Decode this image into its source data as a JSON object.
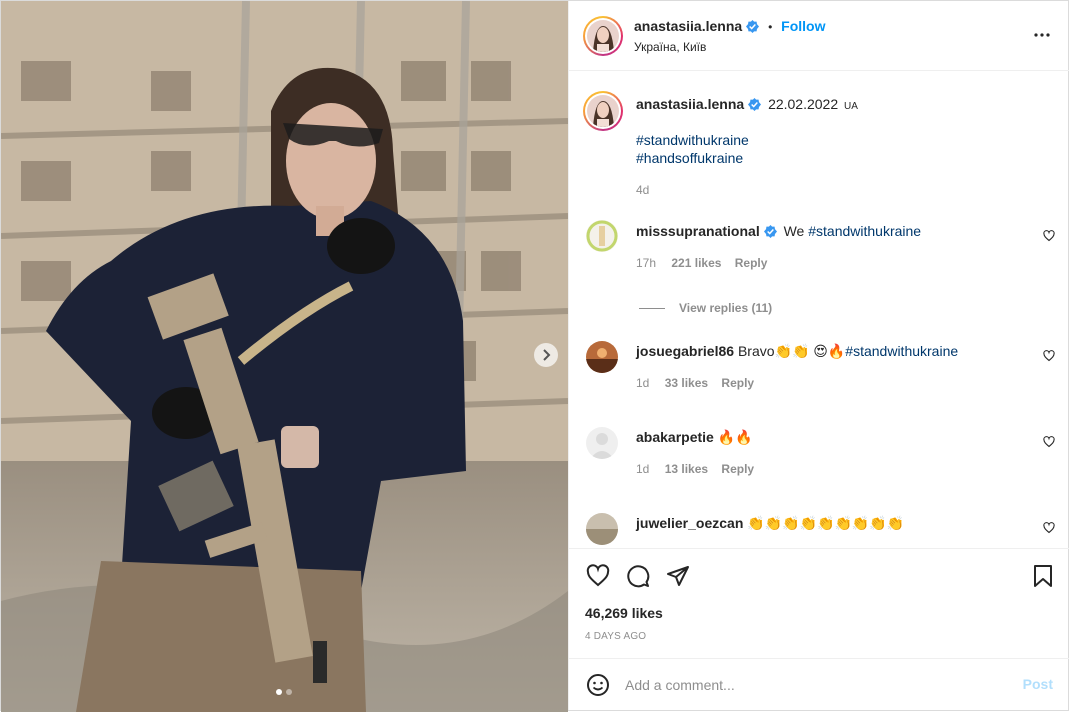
{
  "header": {
    "username": "anastasiia.lenna",
    "separator": "•",
    "follow_label": "Follow",
    "location": "Україна, Київ"
  },
  "caption": {
    "username": "anastasiia.lenna",
    "date": "22.02.2022",
    "flag": "UA",
    "hashtag_1": "#standwithukraine",
    "hashtag_2": "#handsoffukraine",
    "time": "4d"
  },
  "comments": [
    {
      "username": "misssupranational",
      "verified": true,
      "text": "We ",
      "hashtag": "#standwithukraine",
      "time": "17h",
      "likes": "221 likes",
      "reply": "Reply"
    },
    {
      "username": "josuegabriel86",
      "text": "Bravo👏👏 😍🔥",
      "hashtag": "#standwithukraine",
      "time": "1d",
      "likes": "33 likes",
      "reply": "Reply"
    },
    {
      "username": "abakarpetie",
      "text": "🔥🔥",
      "time": "1d",
      "likes": "13 likes",
      "reply": "Reply"
    },
    {
      "username": "juwelier_oezcan",
      "text": "👏👏👏👏👏👏👏👏👏"
    }
  ],
  "view_replies": "View replies (11)",
  "actions": {
    "likes": "46,269 likes",
    "date": "4 DAYS AGO"
  },
  "add_comment": {
    "placeholder": "Add a comment...",
    "post_label": "Post"
  },
  "carousel": {
    "current": 1,
    "total": 2
  },
  "colors": {
    "accent": "#0095f6",
    "hashtag": "#00376b",
    "muted": "#8e8e8e",
    "post_disabled": "#b2dffc"
  },
  "icons": [
    "verified-icon",
    "more-icon",
    "heart-icon",
    "comment-icon",
    "share-icon",
    "bookmark-icon",
    "emoji-icon",
    "chevron-right-icon"
  ]
}
